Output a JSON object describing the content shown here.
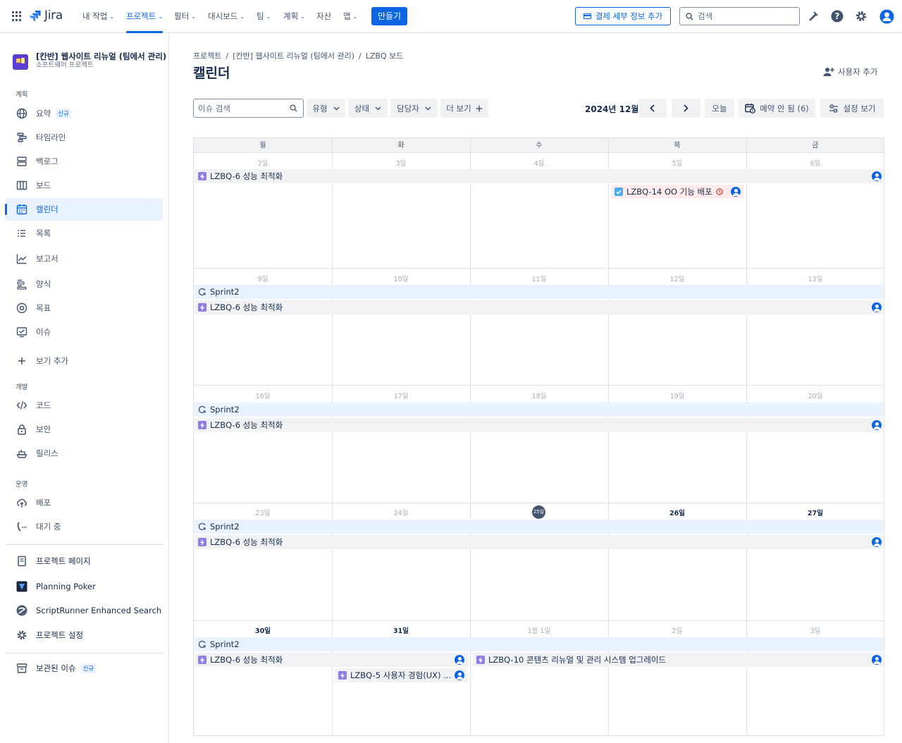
{
  "topnav": {
    "logo_text": "Jira",
    "items": [
      {
        "label": "내 작업"
      },
      {
        "label": "프로젝트"
      },
      {
        "label": "필터"
      },
      {
        "label": "대시보드"
      },
      {
        "label": "팀"
      },
      {
        "label": "계획"
      },
      {
        "label": "자산"
      },
      {
        "label": "앱"
      }
    ],
    "create_label": "만들기",
    "billing_label": "결제 세부 정보 추가",
    "search_placeholder": "검색"
  },
  "sidebar": {
    "project_name": "[칸반] 웹사이트 리뉴얼 (팀에서 관리)",
    "project_type": "소프트웨어 프로젝트",
    "section_plan": "계획",
    "plan_items": [
      {
        "label": "요약",
        "badge": "신규"
      },
      {
        "label": "타임라인"
      },
      {
        "label": "백로그"
      },
      {
        "label": "보드"
      },
      {
        "label": "캘린더"
      },
      {
        "label": "목록"
      },
      {
        "label": "보고서"
      },
      {
        "label": "양식"
      },
      {
        "label": "목표"
      },
      {
        "label": "이슈"
      },
      {
        "label": "보기 추가"
      }
    ],
    "section_dev": "개발",
    "dev_items": [
      {
        "label": "코드"
      },
      {
        "label": "보안"
      },
      {
        "label": "릴리스"
      }
    ],
    "section_ops": "운영",
    "ops_items": [
      {
        "label": "배포"
      },
      {
        "label": "대기 중"
      }
    ],
    "extra_items": [
      {
        "label": "프로젝트 페이지"
      },
      {
        "label": "Planning Poker"
      },
      {
        "label": "ScriptRunner Enhanced Search"
      },
      {
        "label": "프로젝트 설정"
      }
    ],
    "archived": {
      "label": "보관된 이슈",
      "badge": "신규"
    }
  },
  "main": {
    "breadcrumb": [
      "프로젝트",
      "[칸반] 웹사이트 리뉴얼 (팀에서 관리)",
      "LZBQ 보드"
    ],
    "title": "캘린더",
    "add_user_label": "사용자 추가",
    "toolbar": {
      "search_placeholder": "이슈 검색",
      "type_label": "유형",
      "status_label": "상태",
      "assignee_label": "담당자",
      "more_label": "더 보기",
      "month_label": "2024년 12월",
      "today_label": "오늘",
      "unscheduled_label": "예약 안 됨 (6)",
      "view_settings_label": "설정 보기"
    }
  },
  "calendar": {
    "weekdays": [
      "월",
      "화",
      "수",
      "목",
      "금"
    ],
    "weeks": [
      {
        "days": [
          "2일",
          "3일",
          "4일",
          "5일",
          "6일"
        ],
        "bright": [
          false,
          false,
          false,
          false,
          false
        ]
      },
      {
        "days": [
          "9일",
          "10일",
          "11일",
          "12일",
          "13일"
        ],
        "bright": [
          false,
          false,
          false,
          false,
          false
        ]
      },
      {
        "days": [
          "16일",
          "17일",
          "18일",
          "19일",
          "20일"
        ],
        "bright": [
          false,
          false,
          false,
          false,
          false
        ]
      },
      {
        "days": [
          "23일",
          "24일",
          "25일",
          "26일",
          "27일"
        ],
        "bright": [
          false,
          false,
          true,
          true,
          true
        ]
      },
      {
        "days": [
          "30일",
          "31일",
          "1월 1일",
          "2일",
          "3일"
        ],
        "bright": [
          true,
          true,
          false,
          false,
          false
        ]
      }
    ],
    "today_text": "25일",
    "sprint_name": "Sprint2",
    "epic_lzbq6": "LZBQ-6 성능 최적화",
    "release_lzbq14": "LZBQ-14 OO 기능 배포",
    "epic_lzbq5": "LZBQ-5 사용자 경험(UX) ...",
    "epic_lzbq10": "LZBQ-10 콘텐츠 리뉴얼 및 관리 시스템 업그레이드"
  },
  "colors": {
    "accent": "#0c66e4",
    "epic": "#8f7ee7",
    "sprint_bg": "#e9f2ff",
    "task_bg": "#f1f2f4",
    "release_bg": "#ffeceb"
  }
}
